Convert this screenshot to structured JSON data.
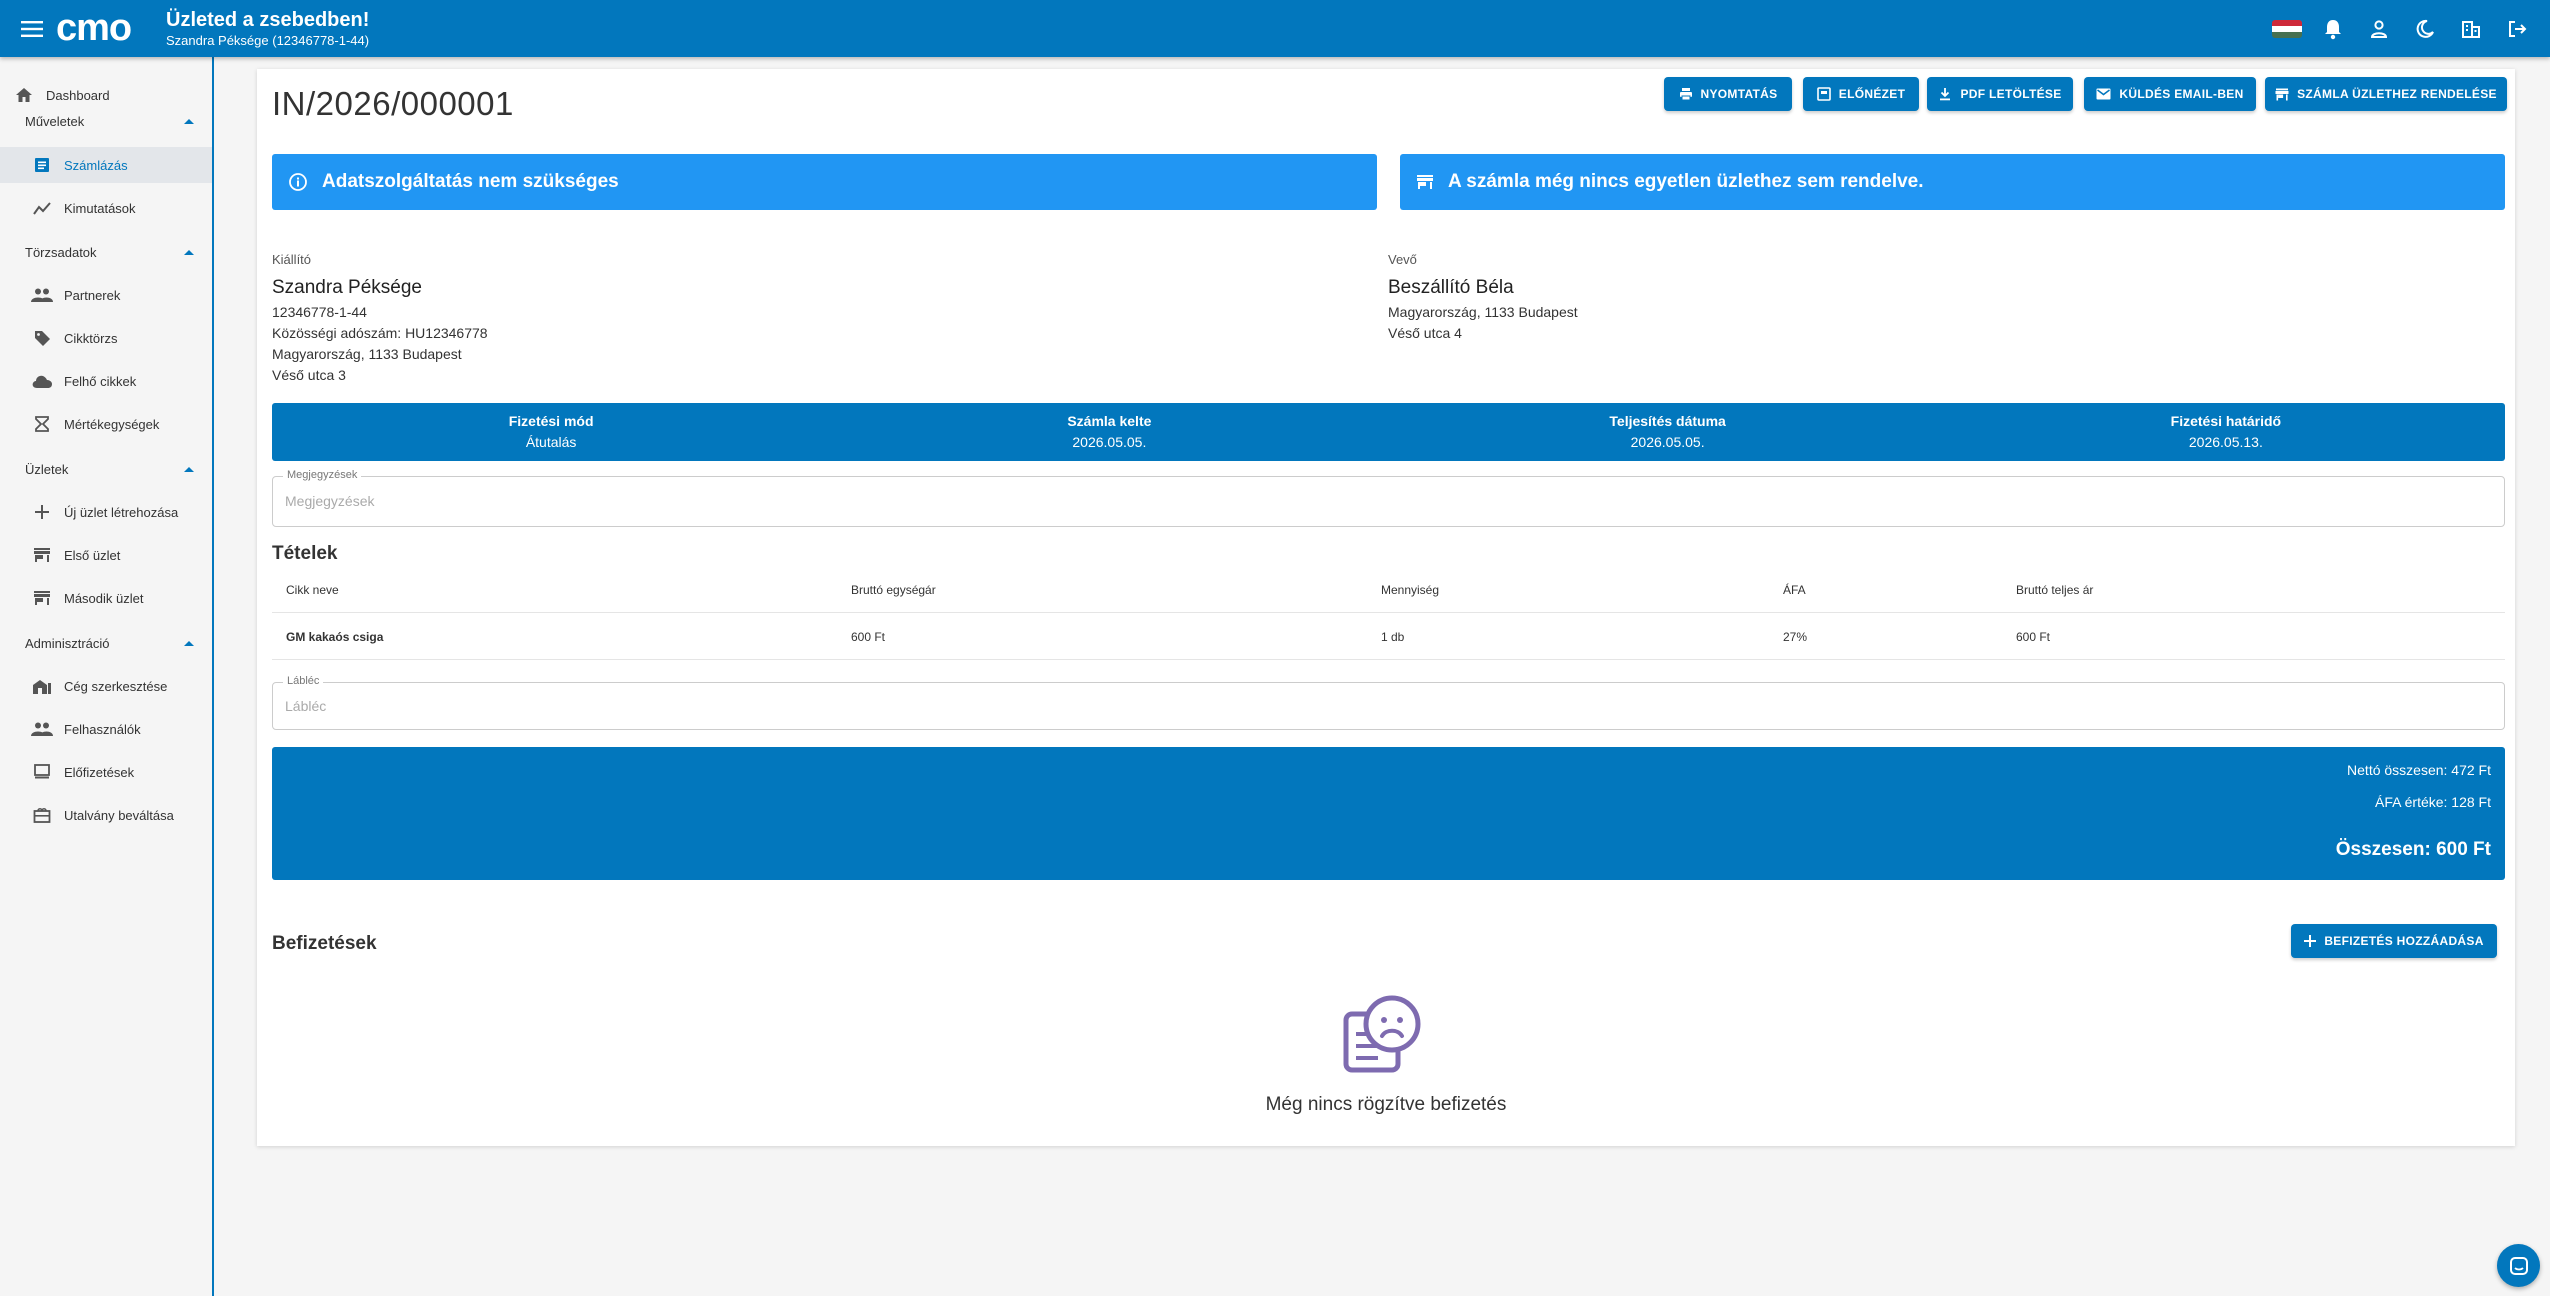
{
  "topbar": {
    "title": "Üzleted a zsebedben!",
    "subtitle": "Szandra Péksége (12346778-1-44)",
    "logo_text": "cmo"
  },
  "sidebar": {
    "dashboard": "Dashboard",
    "groups": {
      "muveletek": "Műveletek",
      "torzsadatok": "Törzsadatok",
      "uzletek": "Üzletek",
      "adminisztracio": "Adminisztráció"
    },
    "items": {
      "szamlazas": "Számlázás",
      "kimutatasok": "Kimutatások",
      "partnerek": "Partnerek",
      "cikktorzs": "Cikktörzs",
      "felho_cikkek": "Felhő cikkek",
      "mertekegysegek": "Mértékegységek",
      "uj_uzlet": "Új üzlet létrehozása",
      "elso_uzlet": "Első üzlet",
      "masodik_uzlet": "Második üzlet",
      "ceg": "Cég szerkesztése",
      "felhasznalok": "Felhasználók",
      "elofizetesek": "Előfizetések",
      "utalvany": "Utalvány beváltása"
    }
  },
  "invoice": {
    "number": "IN/2026/000001",
    "buttons": {
      "print": "NYOMTATÁS",
      "preview": "ELŐNÉZET",
      "pdf": "PDF LETÖLTÉSE",
      "email": "KÜLDÉS EMAIL-BEN",
      "assign": "SZÁMLA ÜZLETHEZ RENDELÉSE"
    },
    "alerts": {
      "left": "Adatszolgáltatás nem szükséges",
      "right": "A számla még nincs egyetlen üzlethez sem rendelve."
    },
    "seller": {
      "label": "Kiállító",
      "name": "Szandra Péksége",
      "tax": "12346778-1-44",
      "eu_tax": "Közösségi adószám: HU12346778",
      "city": "Magyarország, 1133 Budapest",
      "street": "Véső utca 3"
    },
    "buyer": {
      "label": "Vevő",
      "name": "Beszállító Béla",
      "city": "Magyarország, 1133 Budapest",
      "street": "Véső utca 4"
    },
    "meta": [
      {
        "head": "Fizetési mód",
        "value": "Átutalás"
      },
      {
        "head": "Számla kelte",
        "value": "2026.05.05."
      },
      {
        "head": "Teljesítés dátuma",
        "value": "2026.05.05."
      },
      {
        "head": "Fizetési határidő",
        "value": "2026.05.13."
      }
    ],
    "notes": {
      "label": "Megjegyzések",
      "placeholder": "Megjegyzések"
    },
    "items_title": "Tételek",
    "table": {
      "headers": [
        "Cikk neve",
        "Bruttó egységár",
        "Mennyiség",
        "ÁFA",
        "Bruttó teljes ár"
      ],
      "rows": [
        [
          "GM kakaós csiga",
          "600 Ft",
          "1 db",
          "27%",
          "600 Ft"
        ]
      ]
    },
    "footer": {
      "label": "Lábléc",
      "placeholder": "Lábléc"
    },
    "totals": {
      "net": "Nettó összesen: 472 Ft",
      "vat": "ÁFA értéke: 128 Ft",
      "total": "Összesen: 600 Ft"
    },
    "payments": {
      "title": "Befizetések",
      "add_button": "BEFIZETÉS HOZZÁADÁSA",
      "empty": "Még nincs rögzítve befizetés"
    }
  },
  "colors": {
    "primary": "#0277bd",
    "alert": "#2196f3",
    "empty_icon": "#7e6bb0"
  }
}
